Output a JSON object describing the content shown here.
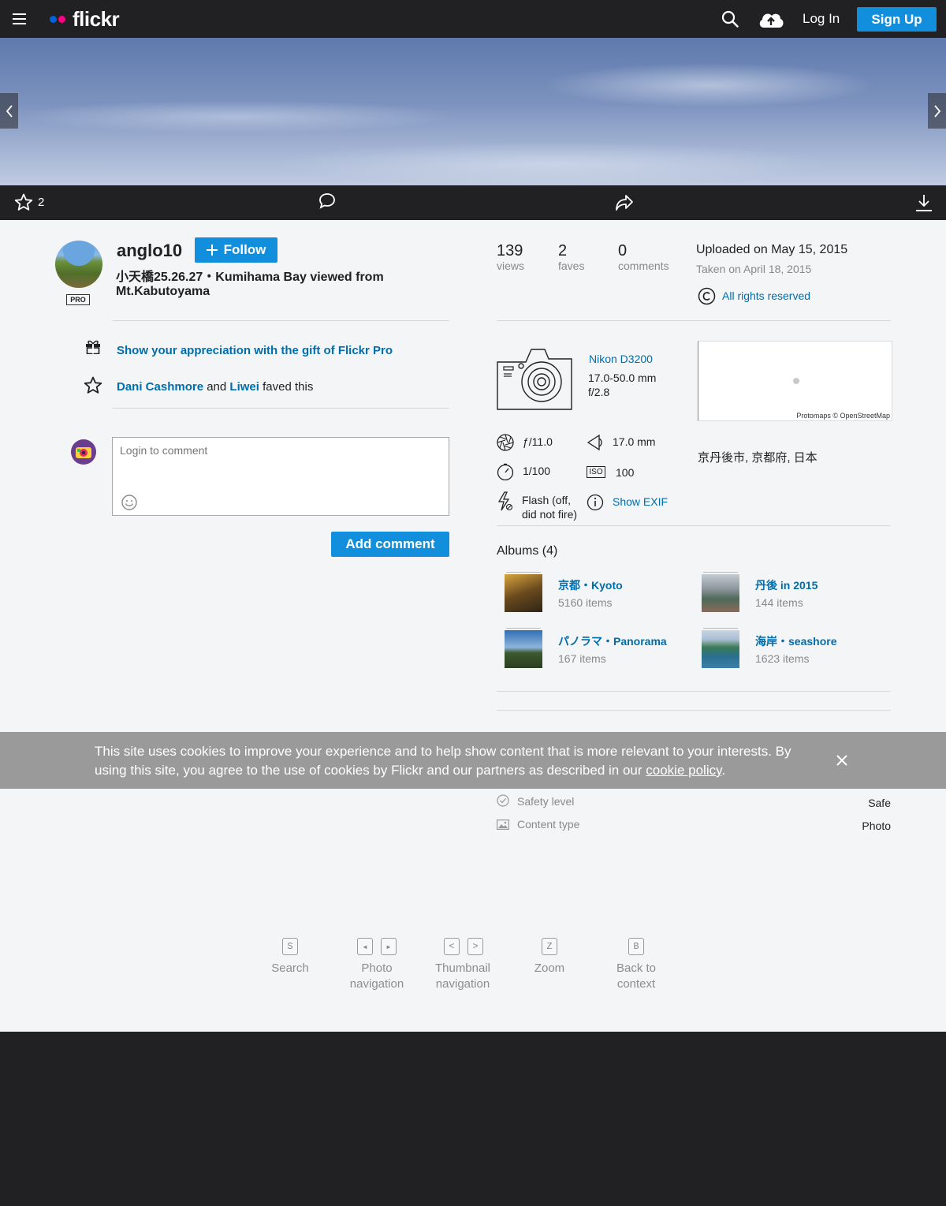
{
  "header": {
    "logo_text": "flickr",
    "login_label": "Log In",
    "signup_label": "Sign Up"
  },
  "actionbar": {
    "fave_count": "2"
  },
  "owner": {
    "username": "anglo10",
    "pro_badge": "PRO",
    "follow_label": "Follow",
    "photo_title": "小天橋25.26.27・Kumihama Bay viewed from Mt.Kabutoyama"
  },
  "gift": {
    "text": "Show your appreciation with the gift of Flickr Pro"
  },
  "faves": {
    "user1": "Dani Cashmore",
    "and_text": "and",
    "user2": "Liwei",
    "suffix": "faved this"
  },
  "comment": {
    "placeholder": "Login to comment",
    "add_label": "Add comment"
  },
  "stats": {
    "views_count": "139",
    "views_label": "views",
    "faves_count": "2",
    "faves_label": "faves",
    "comments_count": "0",
    "comments_label": "comments",
    "uploaded": "Uploaded on May 15, 2015",
    "taken": "Taken on April 18, 2015",
    "license": "All rights reserved"
  },
  "camera": {
    "model": "Nikon D3200",
    "lens": "17.0-50.0 mm",
    "aperture_max": "f/2.8",
    "aperture": "ƒ/11.0",
    "focal_length": "17.0 mm",
    "shutter": "1/100",
    "iso_label": "ISO",
    "iso": "100",
    "flash": "Flash (off, did not fire)",
    "show_exif": "Show EXIF"
  },
  "map": {
    "attribution": "Protomaps © OpenStreetMap",
    "location": "京丹後市, 京都府, 日本"
  },
  "albums": {
    "heading": "Albums (4)",
    "items": [
      {
        "title": "京都・Kyoto",
        "count": "5160 items",
        "color": "#8a6a2a"
      },
      {
        "title": "丹後 in 2015",
        "count": "144 items",
        "color": "#6f7a72"
      },
      {
        "title": "パノラマ・Panorama",
        "count": "167 items",
        "color": "#3f6fa0"
      },
      {
        "title": "海岸・seashore",
        "count": "1623 items",
        "color": "#3f7e95"
      }
    ]
  },
  "cookie": {
    "text_before": "This site uses cookies to improve your experience and to help show content that is more relevant to your interests. By using this site, you agree to the use of cookies by Flickr and our partners as described in our ",
    "link": "cookie policy",
    "text_after": "."
  },
  "safety": {
    "safety_label": "Safety level",
    "safety_value": "Safe",
    "content_label": "Content type",
    "content_value": "Photo"
  },
  "shortcuts": {
    "search_key": "S",
    "search_label": "Search",
    "photo_prev_key": "◂",
    "photo_next_key": "▸",
    "photo_label_1": "Photo",
    "photo_label_2": "navigation",
    "thumb_prev_key": "<",
    "thumb_next_key": ">",
    "thumb_label_1": "Thumbnail",
    "thumb_label_2": "navigation",
    "zoom_key": "Z",
    "zoom_label": "Zoom",
    "back_key": "B",
    "back_label_1": "Back to",
    "back_label_2": "context"
  }
}
